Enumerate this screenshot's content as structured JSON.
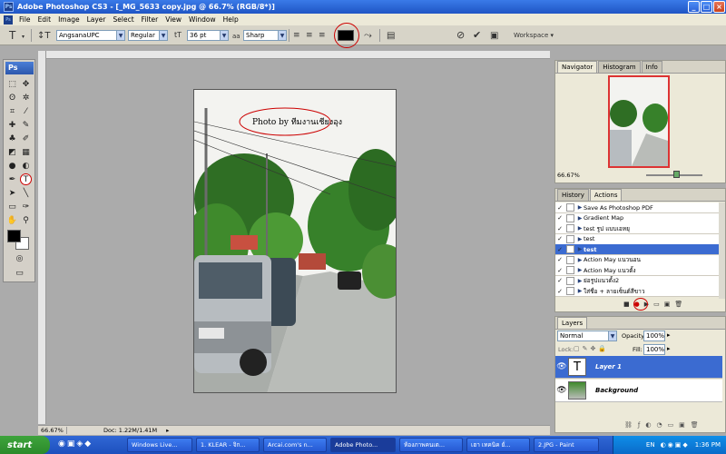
{
  "window": {
    "title": "Adobe Photoshop CS3 - [_MG_5633 copy.jpg @ 66.7% (RGB/8*)]",
    "min": "_",
    "max": "□",
    "close": "×"
  },
  "menu": [
    "File",
    "Edit",
    "Image",
    "Layer",
    "Select",
    "Filter",
    "View",
    "Window",
    "Help"
  ],
  "options": {
    "font_family": "AngsanaUPC",
    "font_style": "Regular",
    "font_size": "36 pt",
    "aa_label": "aa",
    "antialias": "Sharp",
    "workspace": "Workspace ▾",
    "text_color": "#000000"
  },
  "document": {
    "overlay_text": "Photo by ทีมงานเชียงอุง"
  },
  "status": {
    "zoom": "66.67%",
    "doc": "Doc: 1.22M/1.41M"
  },
  "navigator": {
    "tabs": [
      "Navigator",
      "Histogram",
      "Info"
    ],
    "zoom": "66.67%"
  },
  "actions": {
    "tabs": [
      "History",
      "Actions"
    ],
    "items": [
      {
        "label": "Save As Photoshop PDF",
        "sel": false
      },
      {
        "label": "Gradient Map",
        "sel": false
      },
      {
        "label": "test รูป แบบเอหยุ",
        "sel": false
      },
      {
        "label": "test",
        "sel": false
      },
      {
        "label": "test",
        "sel": true
      },
      {
        "label": "Action May แนวนอน",
        "sel": false
      },
      {
        "label": "Action May แนวตั้ง",
        "sel": false
      },
      {
        "label": "ย่อรูปแนวตั้ง2",
        "sel": false
      },
      {
        "label": "ใส่ชื่อ + ลายเซ็นต์สีขาว",
        "sel": false
      }
    ]
  },
  "layers": {
    "tabs": [
      "Layers"
    ],
    "blend": "Normal",
    "opacity_label": "Opacity:",
    "opacity": "100%",
    "lock_label": "Lock:",
    "fill_label": "Fill:",
    "fill": "100%",
    "items": [
      {
        "name": "Layer 1",
        "sel": true,
        "thumb": "T"
      },
      {
        "name": "Background",
        "sel": false,
        "thumb": ""
      }
    ]
  },
  "taskbar": {
    "start": "start",
    "tasks": [
      "Windows Live...",
      "1. KLEAR - จิก...",
      "Arcai.com's n...",
      "Adobe Photo...",
      "ห้องภาพคนเต...",
      "เฮา เทคนิค ยั่...",
      "2.JPG - Paint"
    ],
    "lang": "EN",
    "time": "1:36 PM"
  }
}
